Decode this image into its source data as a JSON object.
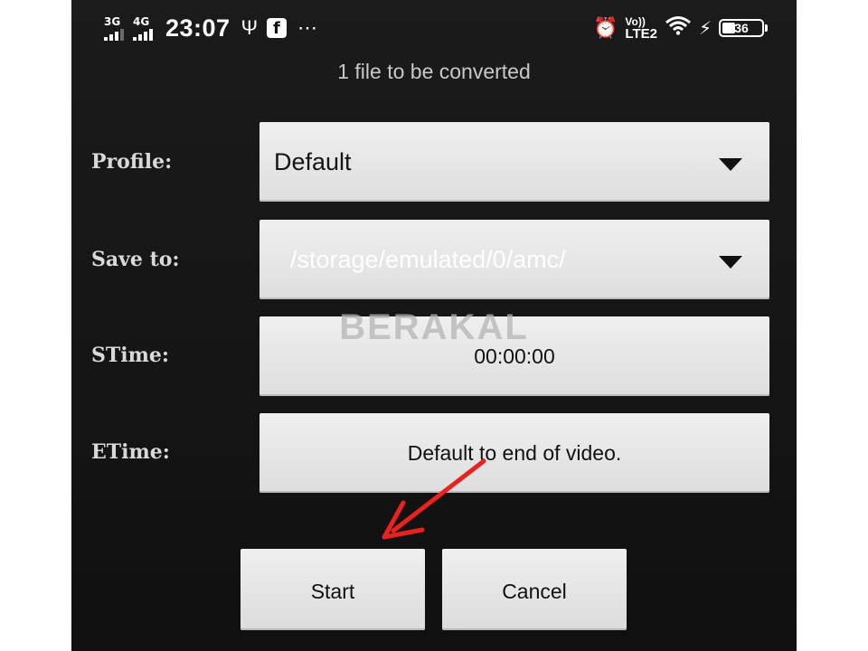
{
  "status_bar": {
    "signal_1_label": "3G",
    "signal_2_label": "4G",
    "time": "23:07",
    "volte_top": "Vo))",
    "volte_bottom": "LTE2",
    "battery_level": "36",
    "icons": [
      "usb-icon",
      "facebook-icon",
      "more-notifications-icon",
      "alarm-icon",
      "wifi-icon",
      "charging-icon",
      "battery-icon"
    ]
  },
  "header": {
    "subtitle": "1  file to be converted"
  },
  "form": {
    "profile": {
      "label": "Profile:",
      "value": "Default"
    },
    "save_to": {
      "label": "Save to:",
      "value": "/storage/emulated/0/amc/"
    },
    "stime": {
      "label": "STime:",
      "value": "00:00:00"
    },
    "etime": {
      "label": "ETime:",
      "value": "Default to end of video."
    }
  },
  "actions": {
    "start_label": "Start",
    "cancel_label": "Cancel"
  },
  "watermark": "BERAKAL",
  "colors": {
    "background": "#121212",
    "field": "#e6e6e6",
    "annotation_arrow": "#e8231f"
  }
}
